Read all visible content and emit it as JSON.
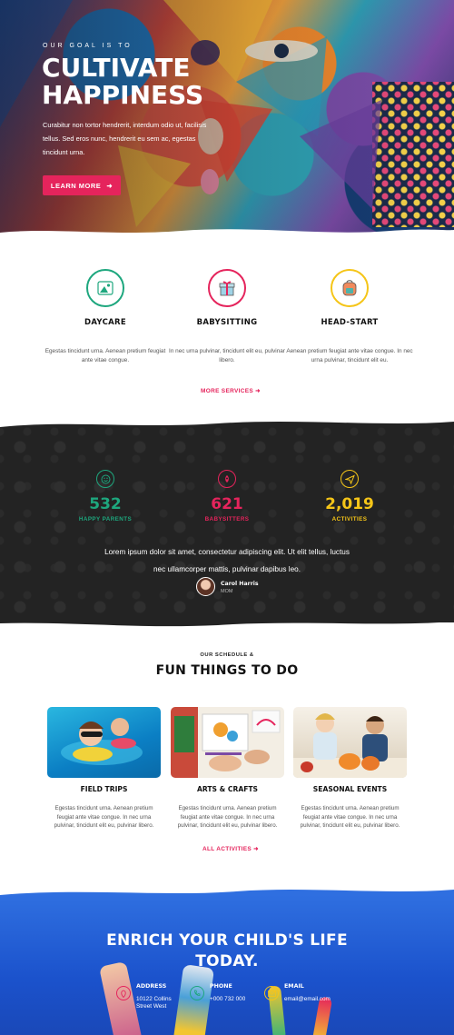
{
  "hero": {
    "eyebrow": "OUR GOAL IS TO",
    "title_line1": "CULTIVATE",
    "title_line2": "HAPPINESS",
    "text": "Curabitur non tortor hendrerit, interdum odio ut, facilisis tellus. Sed eros nunc, hendrerit eu sem ac, egestas tincidunt urna.",
    "button_label": "LEARN MORE",
    "button_icon": "arrow-right-icon",
    "accent": "#e5245c"
  },
  "services": {
    "items": [
      {
        "title": "DAYCARE",
        "text": "Egestas tincidunt urna. Aenean pretium feugiat ante vitae congue.",
        "icon": "picture-icon",
        "color": "#1ea77e"
      },
      {
        "title": "BABYSITTING",
        "text": "In nec urna pulvinar, tincidunt elit eu, pulvinar libero.",
        "icon": "gift-icon",
        "color": "#e5245c"
      },
      {
        "title": "HEAD-START",
        "text": "Aenean pretium feugiat ante vitae congue. In nec urna pulvinar, tincidunt elit eu.",
        "icon": "backpack-icon",
        "color": "#f5c518"
      }
    ],
    "more_label": "MORE SERVICES"
  },
  "stats": {
    "items": [
      {
        "number": "532",
        "label": "HAPPY PARENTS",
        "icon": "smile-icon",
        "color": "#1ea77e"
      },
      {
        "number": "621",
        "label": "BABYSITTERS",
        "icon": "rocket-icon",
        "color": "#e5245c"
      },
      {
        "number": "2,019",
        "label": "ACTIVITIES",
        "icon": "paper-plane-icon",
        "color": "#f5c518"
      }
    ],
    "quote": "Lorem ipsum dolor sit amet, consectetur adipiscing elit. Ut elit tellus, luctus nec ullamcorper mattis, pulvinar dapibus leo.",
    "author_name": "Carol Harris",
    "author_role": "MOM"
  },
  "schedule": {
    "eyebrow": "OUR SCHEDULE &",
    "title": "FUN THINGS TO DO",
    "cards": [
      {
        "title": "FIELD TRIPS",
        "text": "Egestas tincidunt urna. Aenean pretium feugiat ante vitae congue. In nec urna pulvinar, tincidunt elit eu, pulvinar libero."
      },
      {
        "title": "ARTS & CRAFTS",
        "text": "Egestas tincidunt urna. Aenean pretium feugiat ante vitae congue. In nec urna pulvinar, tincidunt elit eu, pulvinar libero."
      },
      {
        "title": "SEASONAL EVENTS",
        "text": "Egestas tincidunt urna. Aenean pretium feugiat ante vitae congue. In nec urna pulvinar, tincidunt elit eu, pulvinar libero."
      }
    ],
    "all_label": "ALL ACTIVITIES"
  },
  "cta": {
    "line1": "ENRICH YOUR CHILD'S LIFE",
    "line2": "TODAY.",
    "contacts": [
      {
        "label": "ADDRESS",
        "value1": "10122 Collins",
        "value2": "Street West",
        "icon": "map-pin-icon",
        "color": "#e5245c"
      },
      {
        "label": "PHONE",
        "value1": "+000 732 000",
        "value2": "",
        "icon": "phone-icon",
        "color": "#1ea77e"
      },
      {
        "label": "EMAIL",
        "value1": "email@email.com",
        "value2": "",
        "icon": "mail-icon",
        "color": "#f5c518"
      }
    ]
  }
}
